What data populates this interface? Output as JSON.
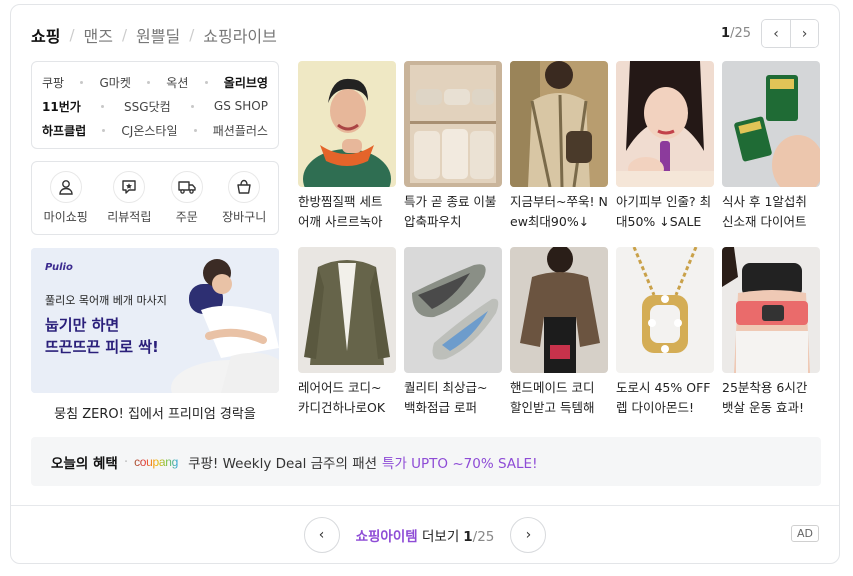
{
  "tabs": [
    "쇼핑",
    "맨즈",
    "원쁠딜",
    "쇼핑라이브"
  ],
  "pager": {
    "current": "1",
    "total": "/25",
    "prev_icon": "chevron-left-icon",
    "next_icon": "chevron-right-icon"
  },
  "malls": {
    "row1": [
      "쿠팡",
      "G마켓",
      "옥션",
      "올리브영"
    ],
    "row2": [
      "11번가",
      "SSG닷컴",
      "GS SHOP"
    ],
    "row3": [
      "하프클럽",
      "CJ온스타일",
      "패션플러스"
    ]
  },
  "my_shopping": [
    {
      "label": "마이쇼핑",
      "icon": "person-icon"
    },
    {
      "label": "리뷰적립",
      "icon": "review-icon"
    },
    {
      "label": "주문",
      "icon": "truck-icon"
    },
    {
      "label": "장바구니",
      "icon": "basket-icon"
    }
  ],
  "banner": {
    "brand": "Pulio",
    "sub": "풀리오 목어깨 베개 마사지",
    "head1": "눕기만 하면",
    "head2": "뜨끈뜨끈 피로 싹!",
    "caption": "뭉침 ZERO! 집에서 프리미엄 경락을"
  },
  "products": [
    {
      "title": "한방찜질팩 세트 어깨 사르르녹아"
    },
    {
      "title": "특가 곧 종료 이불압축파우치"
    },
    {
      "title": "지금부터~쭈욱! New최대90%↓"
    },
    {
      "title": "아기피부 인줄? 최대50% ↓SALE"
    },
    {
      "title": "식사 후 1알섭취 신소재 다이어트"
    },
    {
      "title": "레어어드 코디~ 카디건하나로OK"
    },
    {
      "title": "퀄리티 최상급~ 백화점급 로퍼"
    },
    {
      "title": "핸드메이드 코디 할인받고 득템해"
    },
    {
      "title": "도로시 45% OFF 렙 다이아몬드!"
    },
    {
      "title": "25분착용 6시간 뱃살 운동 효과!"
    }
  ],
  "benefit": {
    "label": "오늘의 혜택",
    "brand": "coupang",
    "text": "쿠팡! Weekly Deal 금주의 패션",
    "highlight": "특가 UPTO ~70% SALE!"
  },
  "footer": {
    "more_hl": "쇼핑아이템",
    "more": " 더보기",
    "current": "1",
    "total": "/25",
    "ad": "AD"
  },
  "colors": {
    "accent": "#8e4cd6",
    "banner_text": "#2a1f7a"
  }
}
